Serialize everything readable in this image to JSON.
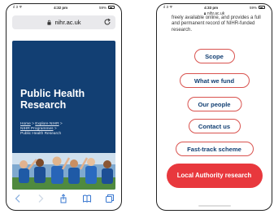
{
  "left_phone": {
    "status": {
      "carrier": "ıl 3 ᯤ",
      "time": "4:32 pm",
      "battery": "59%"
    },
    "url": "nihr.ac.uk",
    "hero": {
      "title": "Public Health Research",
      "breadcrumb": {
        "home": "Home",
        "sep1": " > ",
        "explore": "Explore NIHR",
        "sep2": " > ",
        "programmes": "NIHR Programmes",
        "sep3": " > ",
        "current": "Public Health Research"
      }
    },
    "toolbar": [
      "back",
      "forward",
      "share",
      "bookmarks",
      "tabs"
    ]
  },
  "right_phone": {
    "status": {
      "carrier": "ıl 3 ᯤ",
      "time": "4:33 pm",
      "battery": "59%"
    },
    "url": "nihr.ac.uk",
    "intro_text": "freely available online, and provides a full and permanent record of NIHR-funded research.",
    "buttons": [
      "Scope",
      "What we fund",
      "Our people",
      "Contact us",
      "Fast-track scheme"
    ],
    "primary_button": "Local Authority research"
  },
  "colors": {
    "hero_bg": "#123f73",
    "accent_red": "#e8383d",
    "pill_border": "#d9534f",
    "pill_text": "#123f73"
  }
}
